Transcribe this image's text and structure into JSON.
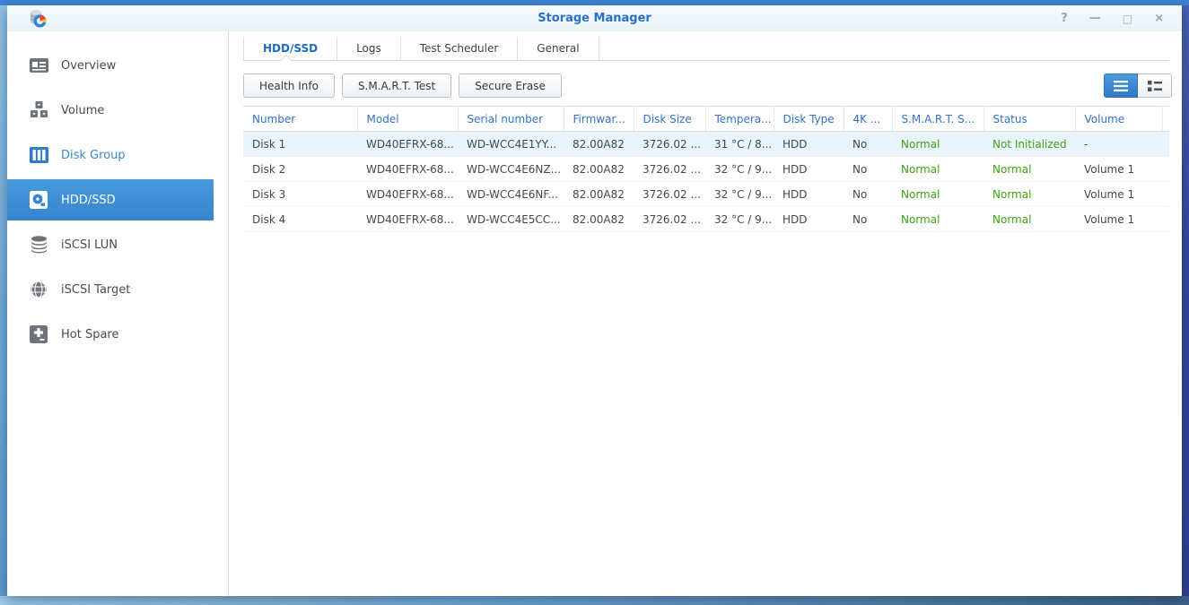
{
  "window": {
    "title": "Storage Manager",
    "controls": {
      "help": "?",
      "minimize": "—",
      "maximize": "□",
      "close": "×"
    }
  },
  "colors": {
    "accent_blue": "#3e8ed8",
    "title_blue": "#2a6fc9",
    "header_blue": "#3273c5",
    "status_green": "#3ba310",
    "row_highlight": "#e9f4fd"
  },
  "sidebar": {
    "items": [
      {
        "label": "Overview"
      },
      {
        "label": "Volume"
      },
      {
        "label": "Disk Group"
      },
      {
        "label": "HDD/SSD"
      },
      {
        "label": "iSCSI LUN"
      },
      {
        "label": "iSCSI Target"
      },
      {
        "label": "Hot Spare"
      }
    ],
    "selected": "HDD/SSD"
  },
  "tabs": [
    {
      "label": "HDD/SSD",
      "active": true
    },
    {
      "label": "Logs",
      "active": false
    },
    {
      "label": "Test Scheduler",
      "active": false
    },
    {
      "label": "General",
      "active": false
    }
  ],
  "toolbar": {
    "health_info": "Health Info",
    "smart_test": "S.M.A.R.T. Test",
    "secure_erase": "Secure Erase"
  },
  "table": {
    "columns": [
      "Number",
      "Model",
      "Serial number",
      "Firmwar...",
      "Disk Size",
      "Tempera...",
      "Disk Type",
      "4K ...",
      "S.M.A.R.T. S...",
      "Status",
      "Volume"
    ],
    "rows": [
      {
        "number": "Disk 1",
        "model": "WD40EFRX-68...",
        "serial": "WD-WCC4E1YY...",
        "firmware": "82.00A82",
        "disk_size": "3726.02 ...",
        "temperature": "31 °C / 8...",
        "disk_type": "HDD",
        "four_k": "No",
        "smart_status": "Normal",
        "status": "Not Initialized",
        "volume": "-"
      },
      {
        "number": "Disk 2",
        "model": "WD40EFRX-68...",
        "serial": "WD-WCC4E6NZ...",
        "firmware": "82.00A82",
        "disk_size": "3726.02 ...",
        "temperature": "32 °C / 9...",
        "disk_type": "HDD",
        "four_k": "No",
        "smart_status": "Normal",
        "status": "Normal",
        "volume": "Volume 1"
      },
      {
        "number": "Disk 3",
        "model": "WD40EFRX-68...",
        "serial": "WD-WCC4E6NF...",
        "firmware": "82.00A82",
        "disk_size": "3726.02 ...",
        "temperature": "32 °C / 9...",
        "disk_type": "HDD",
        "four_k": "No",
        "smart_status": "Normal",
        "status": "Normal",
        "volume": "Volume 1"
      },
      {
        "number": "Disk 4",
        "model": "WD40EFRX-68...",
        "serial": "WD-WCC4E5CC...",
        "firmware": "82.00A82",
        "disk_size": "3726.02 ...",
        "temperature": "32 °C / 9...",
        "disk_type": "HDD",
        "four_k": "No",
        "smart_status": "Normal",
        "status": "Normal",
        "volume": "Volume 1"
      }
    ]
  }
}
